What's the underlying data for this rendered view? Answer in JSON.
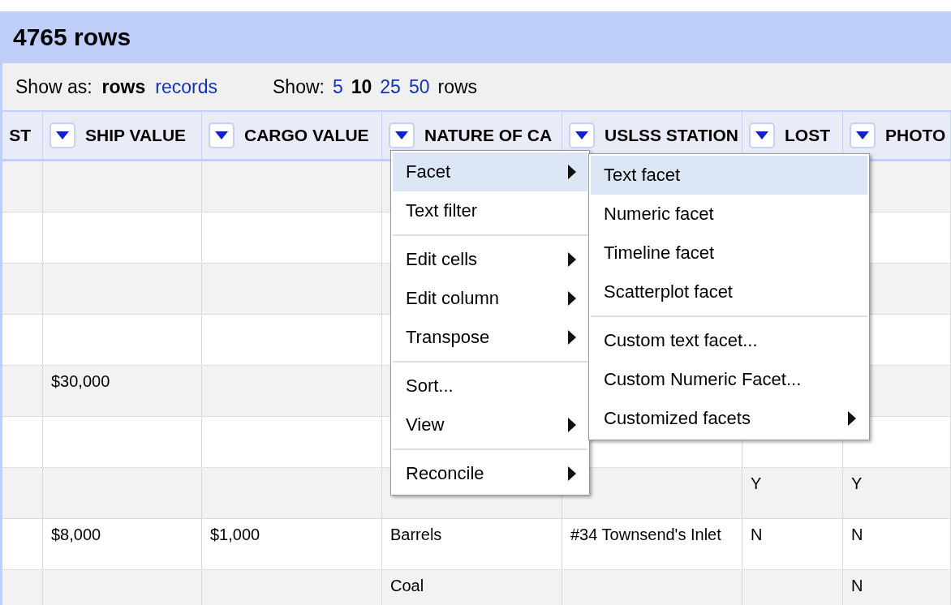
{
  "title": "4765 rows",
  "view_options": {
    "label": "Show as:",
    "modes": [
      {
        "label": "rows",
        "selected": true
      },
      {
        "label": "records",
        "selected": false
      }
    ]
  },
  "page_size": {
    "label": "Show:",
    "options": [
      {
        "label": "5",
        "selected": false
      },
      {
        "label": "10",
        "selected": true
      },
      {
        "label": "25",
        "selected": false
      },
      {
        "label": "50",
        "selected": false
      }
    ],
    "suffix": "rows"
  },
  "columns": [
    {
      "label": "ST",
      "menu_button": false
    },
    {
      "label": "SHIP VALUE",
      "menu_button": true
    },
    {
      "label": "CARGO VALUE",
      "menu_button": true
    },
    {
      "label": "NATURE OF CA",
      "menu_button": true
    },
    {
      "label": "USLSS STATION",
      "menu_button": true
    },
    {
      "label": "LOST",
      "menu_button": true
    },
    {
      "label": "PHOTO",
      "menu_button": true
    }
  ],
  "rows": [
    {
      "cells": [
        "",
        "",
        "",
        "",
        "",
        "",
        ""
      ]
    },
    {
      "cells": [
        "",
        "",
        "",
        "",
        "",
        "",
        ""
      ]
    },
    {
      "cells": [
        "",
        "",
        "",
        "",
        "",
        "",
        ""
      ]
    },
    {
      "cells": [
        "",
        "",
        "",
        "",
        "",
        "",
        ""
      ]
    },
    {
      "cells": [
        "",
        "$30,000",
        "",
        "",
        "",
        "",
        ""
      ]
    },
    {
      "cells": [
        "",
        "",
        "",
        "",
        "",
        "",
        ""
      ]
    },
    {
      "cells": [
        "",
        "",
        "",
        "",
        "",
        "Y",
        "Y"
      ]
    },
    {
      "cells": [
        "",
        "$8,000",
        "$1,000",
        "Barrels",
        "#34 Townsend's Inlet",
        "N",
        "N"
      ]
    },
    {
      "cells": [
        "",
        "",
        "",
        "Coal",
        "",
        "",
        "N"
      ]
    }
  ],
  "column_menu": {
    "items": [
      {
        "kind": "item",
        "label": "Facet",
        "submenu": true,
        "selected": true
      },
      {
        "kind": "item",
        "label": "Text filter",
        "submenu": false,
        "selected": false
      },
      {
        "kind": "divider"
      },
      {
        "kind": "item",
        "label": "Edit cells",
        "submenu": true,
        "selected": false
      },
      {
        "kind": "item",
        "label": "Edit column",
        "submenu": true,
        "selected": false
      },
      {
        "kind": "item",
        "label": "Transpose",
        "submenu": true,
        "selected": false
      },
      {
        "kind": "divider"
      },
      {
        "kind": "item",
        "label": "Sort...",
        "submenu": false,
        "selected": false
      },
      {
        "kind": "item",
        "label": "View",
        "submenu": true,
        "selected": false
      },
      {
        "kind": "divider"
      },
      {
        "kind": "item",
        "label": "Reconcile",
        "submenu": true,
        "selected": false
      }
    ]
  },
  "facet_submenu": {
    "items": [
      {
        "kind": "item",
        "label": "Text facet",
        "submenu": false,
        "selected": true
      },
      {
        "kind": "item",
        "label": "Numeric facet",
        "submenu": false,
        "selected": false
      },
      {
        "kind": "item",
        "label": "Timeline facet",
        "submenu": false,
        "selected": false
      },
      {
        "kind": "item",
        "label": "Scatterplot facet",
        "submenu": false,
        "selected": false
      },
      {
        "kind": "divider"
      },
      {
        "kind": "item",
        "label": "Custom text facet...",
        "submenu": false,
        "selected": false
      },
      {
        "kind": "item",
        "label": "Custom Numeric Facet...",
        "submenu": false,
        "selected": false
      },
      {
        "kind": "item",
        "label": "Customized facets",
        "submenu": true,
        "selected": false
      }
    ]
  }
}
